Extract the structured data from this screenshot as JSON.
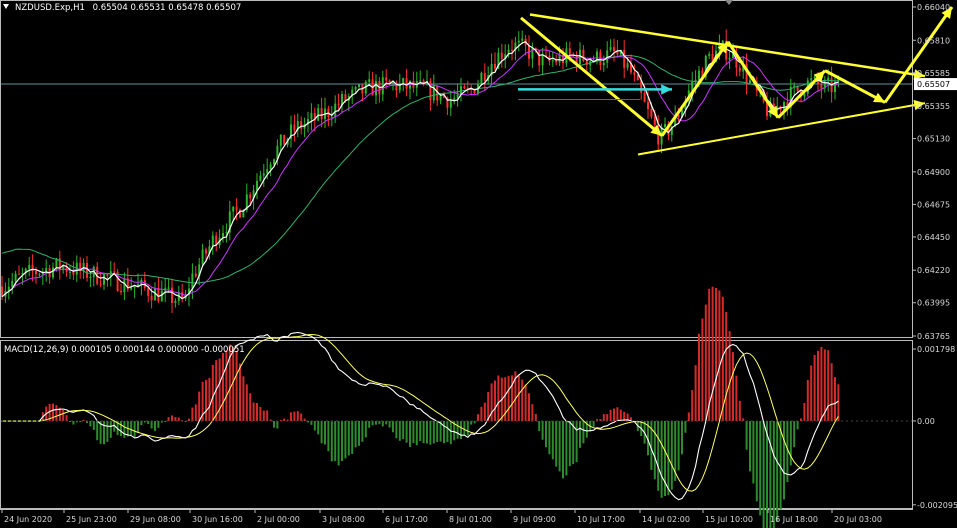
{
  "window": {
    "symbol_title": "NZDUSD.Exp,H1",
    "ohlc": "0.65504 0.65531 0.65478 0.65507",
    "macd_title": "MACD(12,26,9) 0.000105 0.000144 0.000000 -0.000051"
  },
  "colors": {
    "background": "#000000",
    "frame": "#bbbbbb",
    "candle_up": "#2fb52f",
    "candle_down": "#ff3030",
    "ma_fast": "#ffffff",
    "ma_mid": "#cc33ff",
    "ma_slow": "#2eb26b",
    "hist_up": "#d42a2a",
    "hist_down": "#2e8b2e",
    "signal": "#ffff66",
    "macd_line": "#ffffff",
    "annotation": "#ffff33",
    "annotation_arrow": "#33dddd",
    "current_price_line": "#5f8fa0"
  },
  "chart_data": [
    {
      "type": "candlestick",
      "symbol": "NZDUSD",
      "timeframe": "H1",
      "current_price": 0.65507,
      "ylim": [
        0.63765,
        0.6604
      ],
      "y_ticks": [
        "0.66040",
        "0.65810",
        "0.65585",
        "0.65355",
        "0.65130",
        "0.64900",
        "0.64675",
        "0.64450",
        "0.64220",
        "0.63995",
        "0.63765"
      ],
      "x_ticks": [
        "24 Jun 2020",
        "25 Jun 23:00",
        "29 Jun 08:00",
        "30 Jun 16:00",
        "2 Jul 00:00",
        "3 Jul 08:00",
        "6 Jul 17:00",
        "8 Jul 01:00",
        "9 Jul 09:00",
        "10 Jul 17:00",
        "14 Jul 02:00",
        "15 Jul 10:00",
        "16 Jul 18:00",
        "20 Jul 03:00"
      ],
      "price_path": [
        [
          0,
          0.641
        ],
        [
          30,
          0.642
        ],
        [
          60,
          0.6425
        ],
        [
          100,
          0.6418
        ],
        [
          140,
          0.641
        ],
        [
          185,
          0.64
        ],
        [
          190,
          0.6415
        ],
        [
          215,
          0.6445
        ],
        [
          240,
          0.6465
        ],
        [
          270,
          0.65
        ],
        [
          295,
          0.652
        ],
        [
          320,
          0.6528
        ],
        [
          345,
          0.654
        ],
        [
          370,
          0.6548
        ],
        [
          395,
          0.655
        ],
        [
          425,
          0.6547
        ],
        [
          450,
          0.654
        ],
        [
          470,
          0.6545
        ],
        [
          490,
          0.6565
        ],
        [
          510,
          0.6578
        ],
        [
          525,
          0.6575
        ],
        [
          545,
          0.6565
        ],
        [
          570,
          0.657
        ],
        [
          595,
          0.6568
        ],
        [
          615,
          0.6572
        ],
        [
          630,
          0.656
        ],
        [
          645,
          0.6535
        ],
        [
          660,
          0.6513
        ],
        [
          675,
          0.6525
        ],
        [
          690,
          0.6548
        ],
        [
          710,
          0.657
        ],
        [
          725,
          0.6575
        ],
        [
          740,
          0.6565
        ],
        [
          755,
          0.6545
        ],
        [
          770,
          0.653
        ],
        [
          790,
          0.6543
        ],
        [
          810,
          0.6552
        ],
        [
          825,
          0.6548
        ],
        [
          840,
          0.655
        ]
      ],
      "annotations": {
        "triangle_upper_line": [
          [
            0.66
          ],
          [
            0.6553
          ]
        ],
        "triangle_lower_line": [
          [
            0.6505
          ],
          [
            0.6545
          ]
        ],
        "zigzag": [
          0.6601,
          0.6515,
          0.658,
          0.6527,
          0.656,
          0.654,
          0.6604
        ],
        "cyan_arrow_level": 0.6547
      }
    },
    {
      "type": "histogram",
      "name": "MACD(12,26,9)",
      "values_shown": [
        "0.000105",
        "0.000144",
        "0.000000",
        "-0.000051"
      ],
      "ylim": [
        -0.00205,
        0.001798
      ],
      "y_ticks": [
        "0.001798",
        "0.00",
        "-0.002095"
      ]
    }
  ]
}
